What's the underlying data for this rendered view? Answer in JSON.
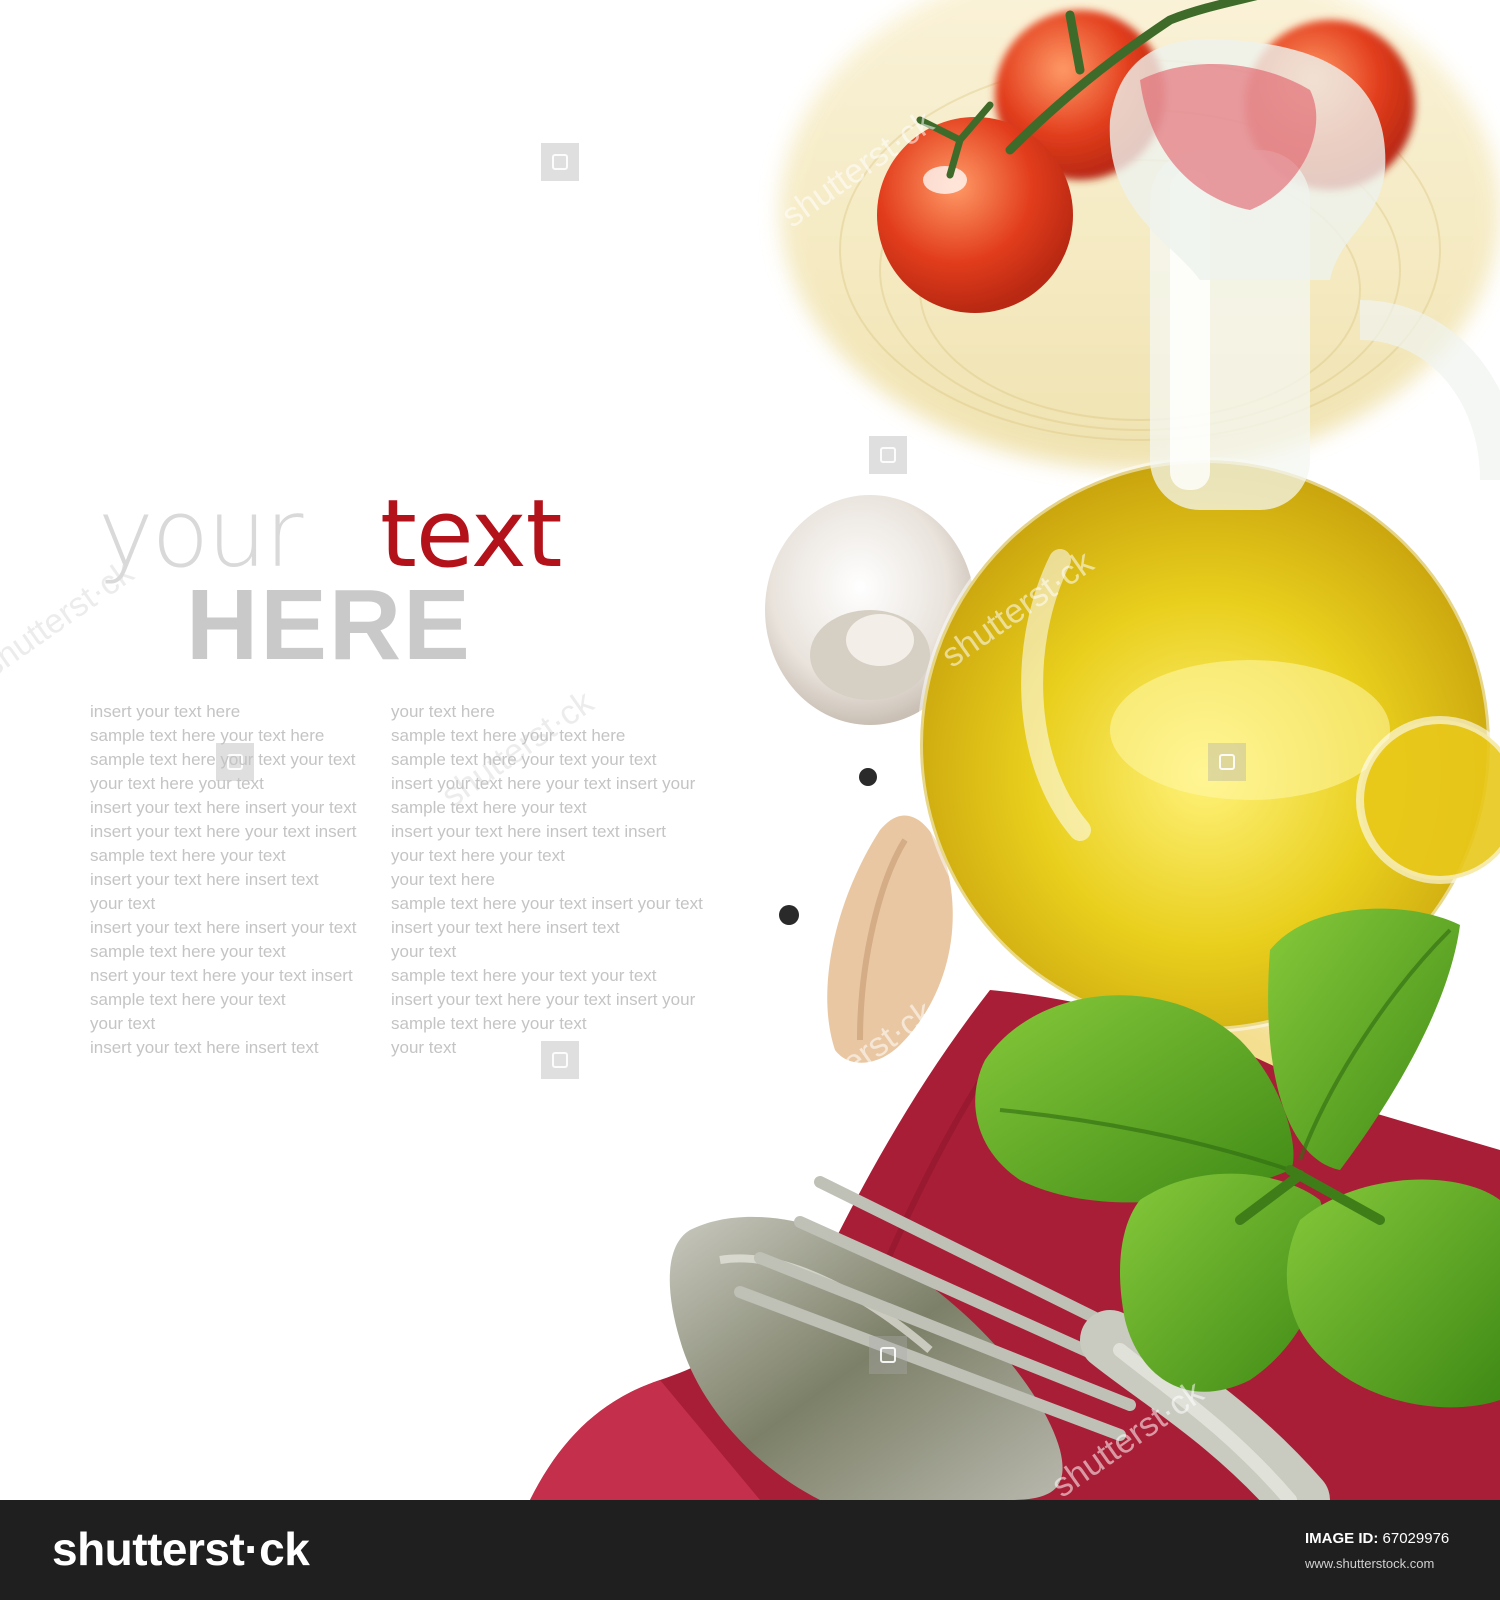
{
  "headline": {
    "word1": "your",
    "word2": "text",
    "word3": "HERE"
  },
  "columns": {
    "left": [
      "insert your text here",
      "sample text here your text here",
      "sample text here your text  your text",
      "your text here your text",
      "insert your text here insert your text",
      "insert your text here your text insert",
      "sample text here your text",
      "insert your text here insert text",
      "your text",
      "insert your text here insert your text",
      "sample text here your text",
      "nsert your text here your text insert",
      "sample text here your text",
      "your text",
      "insert your text here insert text"
    ],
    "right": [
      "your text here",
      "sample text here your text here",
      "sample text here your text  your text",
      "insert your text here your text insert your",
      "sample text here your text",
      "insert your text here insert text insert",
      "your text here your text",
      "your text here",
      "sample text here your text insert your text",
      "insert your text here insert text",
      "your text",
      "sample text here your text  your text",
      "insert your text here your text insert your",
      "sample text here your text",
      "your text"
    ]
  },
  "watermark": {
    "text": "shutterst·ck"
  },
  "footer": {
    "brand": "shutterst·ck",
    "image_id_label": "IMAGE ID:",
    "image_id": "67029976",
    "url": "www.shutterstock.com"
  },
  "colors": {
    "accent_red": "#b3121b",
    "footer_bg": "#1f1f1f",
    "oil": "#e8c81a",
    "basil": "#4a9a1e",
    "napkin": "#a81e36"
  },
  "icons": [
    "watermark-tile-icon"
  ]
}
